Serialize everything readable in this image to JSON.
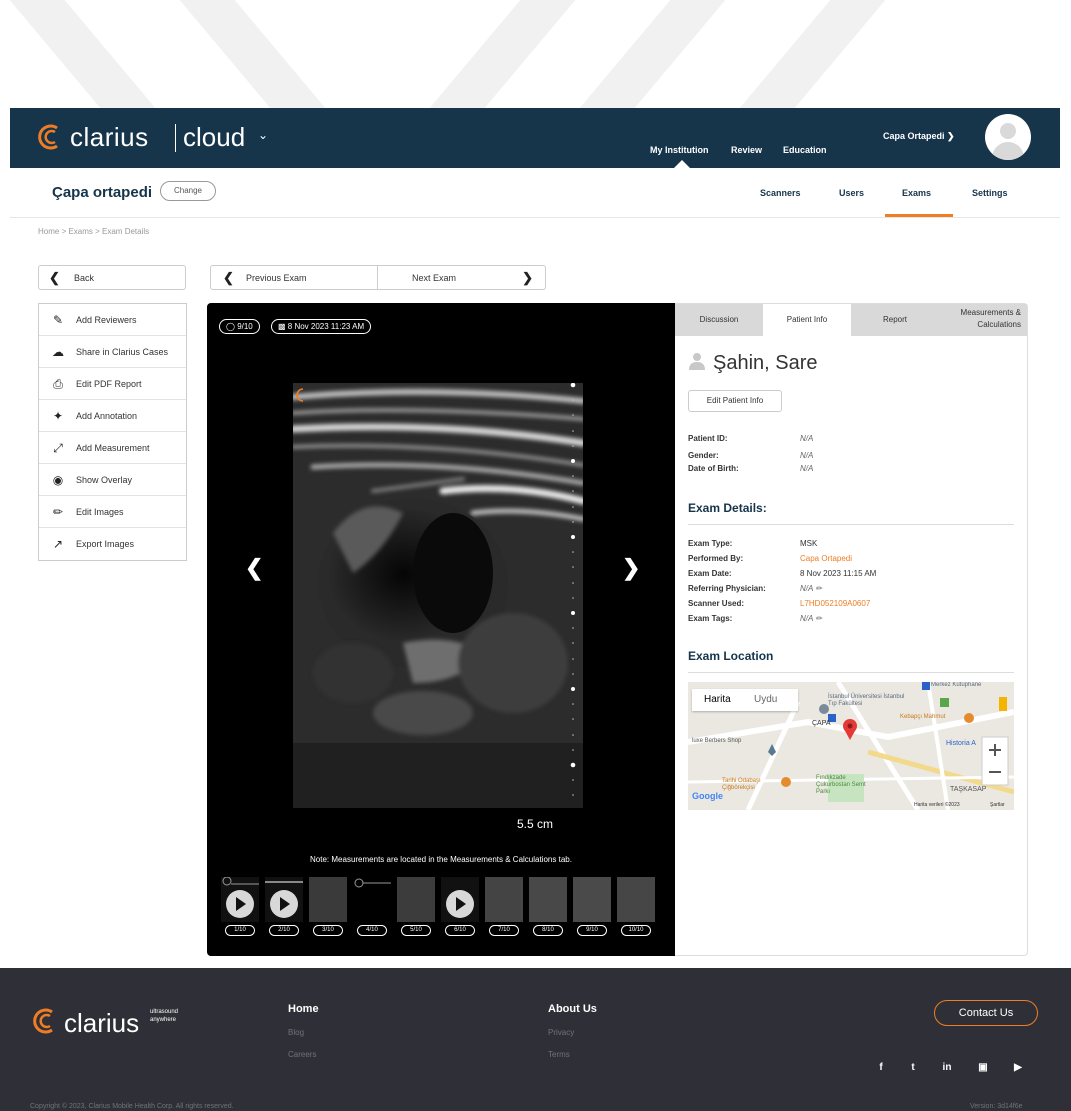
{
  "topbar": {
    "logo": "clarius",
    "product": "cloud",
    "nav": [
      "My Institution",
      "Review",
      "Education"
    ],
    "account": "Capa Ortapedi"
  },
  "subbar": {
    "institution": "Çapa ortapedi",
    "change_label": "Change",
    "nav": [
      "Scanners",
      "Users",
      "Exams",
      "Settings"
    ],
    "active_nav": "Exams"
  },
  "breadcrumb": "Home  >  Exams  >  Exam Details",
  "buttons": {
    "back": "Back",
    "previous": "Previous Exam",
    "next": "Next Exam"
  },
  "actions": [
    {
      "label": "Add Reviewers",
      "icon": "add-reviewer-icon"
    },
    {
      "label": "Share in Clarius Cases",
      "icon": "cloud-upload-icon"
    },
    {
      "label": "Edit PDF Report",
      "icon": "printer-icon"
    },
    {
      "label": "Add Annotation",
      "icon": "pin-icon"
    },
    {
      "label": "Add Measurement",
      "icon": "measure-icon"
    },
    {
      "label": "Show Overlay",
      "icon": "eye-icon"
    },
    {
      "label": "Edit Images",
      "icon": "pencil-icon"
    },
    {
      "label": "Export Images",
      "icon": "export-icon"
    }
  ],
  "viewer": {
    "counter": "9/10",
    "datetime": "8 Nov 2023 11:23 AM",
    "scale": "5.5 cm",
    "note": "Note: Measurements are located in the Measurements & Calculations tab.",
    "thumbnails": [
      "1/10",
      "2/10",
      "3/10",
      "4/10",
      "5/10",
      "6/10",
      "7/10",
      "8/10",
      "9/10",
      "10/10"
    ]
  },
  "panel": {
    "tabs": [
      "Discussion",
      "Patient Info",
      "Report",
      "Measurements & Calculations"
    ],
    "active_tab": "Patient Info",
    "patient_name": "Şahin, Sare",
    "edit_label": "Edit Patient Info",
    "patient_fields": {
      "id_label": "Patient ID:",
      "id": "N/A",
      "gender_label": "Gender:",
      "gender": "N/A",
      "dob_label": "Date of Birth:",
      "dob": "N/A"
    },
    "exam_details_heading": "Exam Details:",
    "exam_fields": {
      "type_label": "Exam Type:",
      "type": "MSK",
      "performed_label": "Performed By:",
      "performed": "Capa Ortapedi",
      "date_label": "Exam Date:",
      "date": "8 Nov 2023 11:15 AM",
      "referring_label": "Referring Physician:",
      "referring": "N/A",
      "scanner_label": "Scanner Used:",
      "scanner": "L7HD052109A0607",
      "tags_label": "Exam Tags:",
      "tags": "N/A"
    },
    "location_heading": "Exam Location",
    "map": {
      "tab_map": "Harita",
      "tab_satellite": "Uydu",
      "labels": [
        "İstanbul Üniversitesi İstanbul Tıp Fakültesi",
        "Merkez Kütüphane",
        "ÇAPA",
        "Kebapçı Mahmut",
        "Historia A",
        "luxe Berbers Shop",
        "Tarihi Odabaşı Çiğbörekçisi",
        "Fındıkzade Çukurbostan Semt Parkı",
        "TAŞKASAP",
        "Google",
        "Harita verileri ©2023",
        "Şartlar"
      ]
    }
  },
  "footer": {
    "brand": "clarius",
    "tagline_1": "ultrasound",
    "tagline_2": "anywhere",
    "col1": {
      "title": "Home",
      "links": [
        "Blog",
        "Careers"
      ]
    },
    "col2": {
      "title": "About Us",
      "links": [
        "Privacy",
        "Terms"
      ]
    },
    "contact": "Contact Us",
    "copyright": "Copyright © 2023, Clarius Mobile Health Corp. All rights reserved.",
    "version": "Version: 3d14f6e"
  },
  "colors": {
    "navy": "#16344a",
    "accent": "#ee7d26",
    "footer": "#2f3037"
  }
}
